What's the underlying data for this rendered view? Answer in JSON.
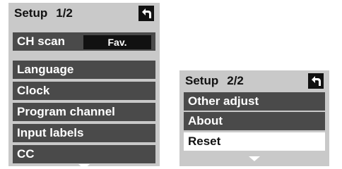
{
  "panel1": {
    "title": "Setup",
    "page": "1/2",
    "back_icon": "back-arrow-icon",
    "ch_scan": {
      "label": "CH scan",
      "value": "Fav."
    },
    "items": [
      {
        "label": "Language"
      },
      {
        "label": "Clock"
      },
      {
        "label": "Program channel"
      },
      {
        "label": "Input labels"
      },
      {
        "label": "CC"
      }
    ],
    "scroll_icon": "scroll-down-icon"
  },
  "panel2": {
    "title": "Setup",
    "page": "2/2",
    "back_icon": "back-arrow-icon",
    "items": [
      {
        "label": "Other adjust",
        "selected": false
      },
      {
        "label": "About",
        "selected": false
      },
      {
        "label": "Reset",
        "selected": true
      }
    ],
    "scroll_icon": "scroll-down-icon"
  },
  "colors": {
    "panel_bg": "#c9c9c9",
    "row_bg": "#4a4a4a",
    "selected_bg": "#ffffff",
    "text_dark": "#111111",
    "text_light": "#ffffff"
  }
}
